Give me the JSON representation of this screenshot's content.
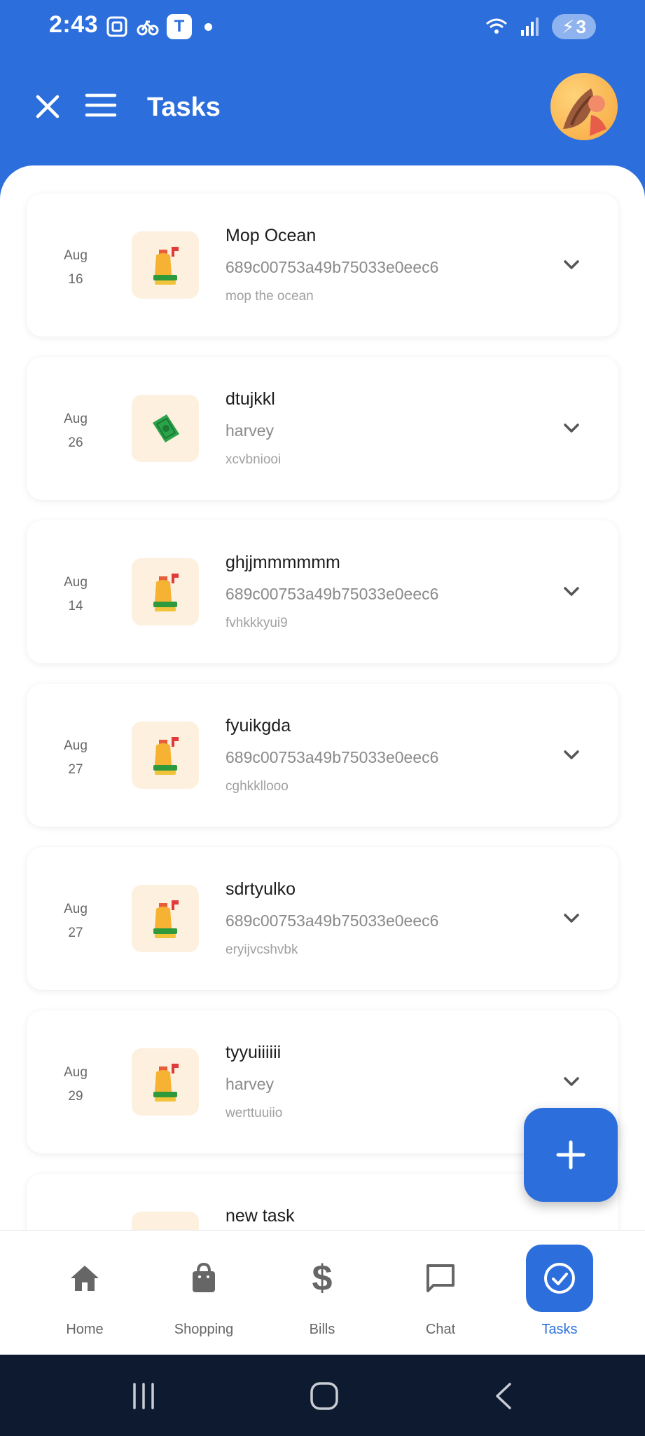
{
  "status_bar": {
    "time": "2:43",
    "app_badge": "T",
    "battery": "3"
  },
  "header": {
    "title": "Tasks"
  },
  "tasks": [
    {
      "month": "Aug",
      "day": "16",
      "title": "Mop Ocean",
      "subtitle": "689c00753a49b75033e0eec6",
      "description": "mop the ocean",
      "icon": "cleaning-supplies-icon"
    },
    {
      "month": "Aug",
      "day": "26",
      "title": "dtujkkl",
      "subtitle": "harvey",
      "description": "xcvbniooi",
      "icon": "money-icon"
    },
    {
      "month": "Aug",
      "day": "14",
      "title": "ghjjmmmmmm",
      "subtitle": "689c00753a49b75033e0eec6",
      "description": "fvhkkkyui9",
      "icon": "cleaning-supplies-icon"
    },
    {
      "month": "Aug",
      "day": "27",
      "title": "fyuikgda",
      "subtitle": "689c00753a49b75033e0eec6",
      "description": "cghkkllooo",
      "icon": "cleaning-supplies-icon"
    },
    {
      "month": "Aug",
      "day": "27",
      "title": "sdrtyulko",
      "subtitle": "689c00753a49b75033e0eec6",
      "description": "eryijvcshvbk",
      "icon": "cleaning-supplies-icon"
    },
    {
      "month": "Aug",
      "day": "29",
      "title": "tyyuiiiiii",
      "subtitle": "harvey",
      "description": "werttuuiio",
      "icon": "cleaning-supplies-icon"
    },
    {
      "month": "",
      "day": "",
      "title": "new task",
      "subtitle": "",
      "description": "",
      "icon": "task-icon"
    }
  ],
  "bottom_nav": [
    {
      "label": "Home",
      "icon": "home-icon",
      "active": false
    },
    {
      "label": "Shopping",
      "icon": "shopping-bag-icon",
      "active": false
    },
    {
      "label": "Bills",
      "icon": "dollar-icon",
      "active": false
    },
    {
      "label": "Chat",
      "icon": "chat-icon",
      "active": false
    },
    {
      "label": "Tasks",
      "icon": "check-circle-icon",
      "active": true
    }
  ],
  "colors": {
    "primary": "#2c6fdc",
    "thumb_bg": "#fdf0de",
    "system_nav": "#0d1a2f"
  }
}
